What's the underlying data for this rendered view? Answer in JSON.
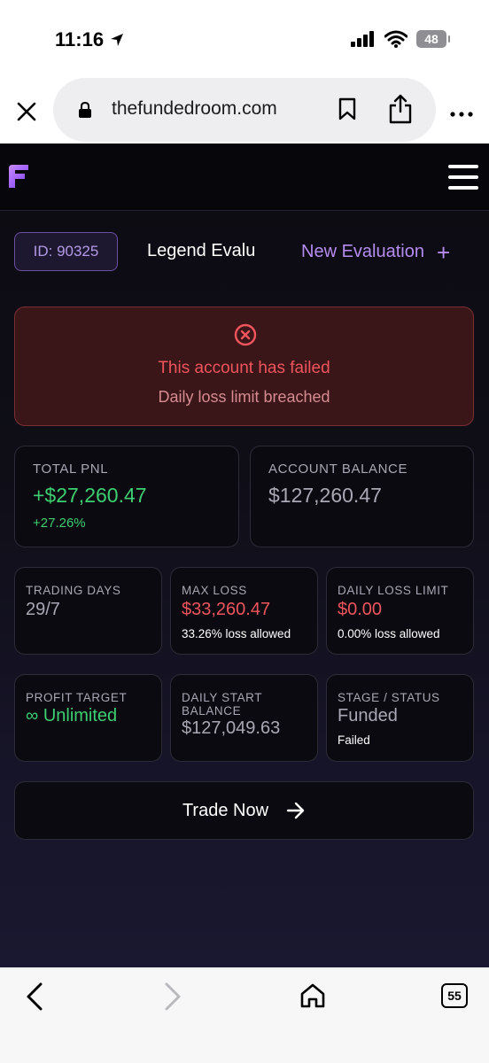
{
  "status_bar": {
    "time": "11:16",
    "battery": "48"
  },
  "browser": {
    "url": "thefundedroom.com",
    "tab_count": "55"
  },
  "account": {
    "id_label": "ID: 90325",
    "name": "Legend Evaluation",
    "new_evaluation_label": "New Evaluation",
    "new_evaluation_icon": "+"
  },
  "alert": {
    "title": "This account has failed",
    "subtitle": "Daily loss limit breached",
    "color": "#f0545c"
  },
  "stats": {
    "total_pnl": {
      "label": "TOTAL PNL",
      "value": "+$27,260.47",
      "sub": "+27.26%"
    },
    "account_balance": {
      "label": "ACCOUNT BALANCE",
      "value": "$127,260.47"
    },
    "trading_days": {
      "label": "TRADING DAYS",
      "value": "29/7"
    },
    "max_loss": {
      "label": "MAX LOSS",
      "value": "$33,260.47",
      "sub": "33.26% loss allowed"
    },
    "daily_loss_limit": {
      "label": "DAILY LOSS LIMIT",
      "value": "$0.00",
      "sub": "0.00% loss allowed"
    },
    "profit_target": {
      "label": "PROFIT TARGET",
      "value": "∞ Unlimited"
    },
    "daily_start_balance": {
      "label": "DAILY START BALANCE",
      "value": "$127,049.63"
    },
    "stage_status": {
      "label": "STAGE / STATUS",
      "value": "Funded",
      "sub": "Failed"
    }
  },
  "trade_button": {
    "label": "Trade Now"
  },
  "colors": {
    "accent": "#b48cf2",
    "positive": "#3ecf72",
    "negative": "#f0545c"
  }
}
